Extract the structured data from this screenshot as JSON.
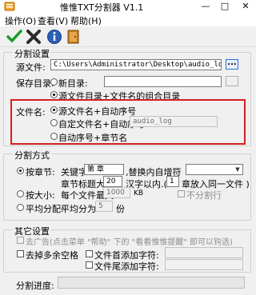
{
  "window": {
    "title": "惟惟TXT分割器 V1.1",
    "min_label": "—",
    "max_label": "□",
    "close_label": "✕"
  },
  "menu": [
    {
      "label": "操作(O)"
    },
    {
      "label": "查看(V)"
    },
    {
      "label": "帮助(H)"
    }
  ],
  "toolbar": {
    "buttons": [
      {
        "name": "confirm",
        "icon": "check-icon"
      },
      {
        "name": "cancel",
        "icon": "x-icon"
      },
      {
        "name": "info",
        "icon": "info-icon"
      },
      {
        "name": "exit",
        "icon": "exit-door-icon"
      }
    ]
  },
  "split_settings": {
    "title": "分割设置",
    "source_label": "源文件:",
    "source_value": "C:\\Users\\Administrator\\Desktop\\audio_log.txt",
    "browse_label": "...",
    "save_dir_label": "保存目录:",
    "new_dir_option": "新目录:",
    "source_dir_option": "源文件目录+文件名的组合目录",
    "filename_label": "文件名:",
    "filename_options": [
      {
        "label": "源文件名+自动序号",
        "selected": true
      },
      {
        "label": "自定文件名+自动序号:",
        "selected": false
      },
      {
        "label": "自动序号+章节名",
        "selected": false
      }
    ],
    "custom_filename_value": "audio_log"
  },
  "split_mode": {
    "title": "分割方式",
    "by_chapter_label": "按章节:",
    "keyword_label": "关键字",
    "keyword_value": "第  章",
    "replace_label": ",替换内自增符",
    "title_size_label": "章节标题大小",
    "title_size_value": "20",
    "within_label": "汉字以内.(",
    "chapters_per_file_value": "1",
    "chapters_per_file_label": "章放入同一文件 )",
    "by_size_label": "按大小:",
    "max_size_label": "每个文件最大",
    "max_size_value": "1000",
    "size_unit": "KB",
    "no_split_label": "不分割行",
    "average_label": "平均分配:",
    "average_into_label": "平均分为",
    "average_value": "5",
    "average_unit": "份"
  },
  "other_settings": {
    "title": "其它设置",
    "ad_option": "去广告(点击菜单 \"帮助\" 下的 \"看看惟惟提醒\" 即可以钩选)",
    "remove_blank": "去掉多余空格",
    "header_add": "文件首添加字符:",
    "footer_add": "文件尾添加字符:",
    "progress_label": "分割进度:",
    "progress_fraction": 0
  }
}
